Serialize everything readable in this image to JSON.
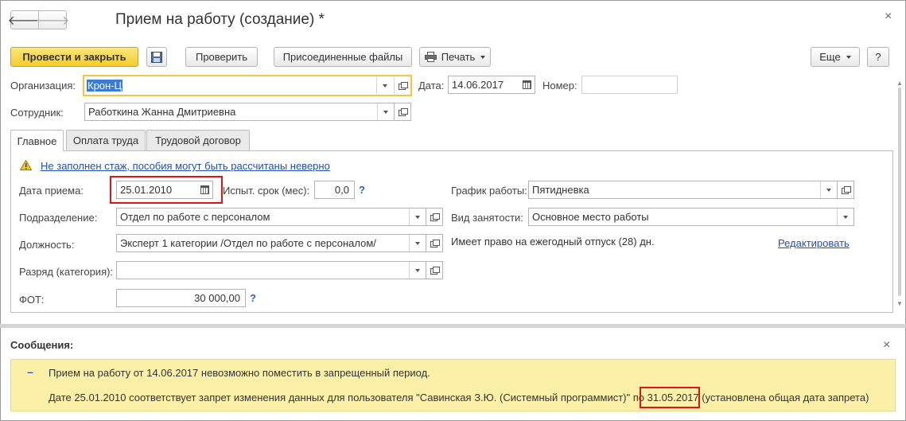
{
  "window": {
    "title": "Прием на работу (создание) *",
    "close_glyph": "×"
  },
  "nav": {
    "back_glyph": "🡐",
    "forward_glyph": "🡒"
  },
  "toolbar": {
    "post_close_label": "Провести и закрыть",
    "check_label": "Проверить",
    "attached_files_label": "Присоединенные файлы",
    "print_label": "Печать",
    "more_label": "Еще",
    "help_label": "?"
  },
  "header": {
    "organization": {
      "label": "Организация:",
      "value": "Крон-Ц"
    },
    "date": {
      "label": "Дата:",
      "value": "14.06.2017"
    },
    "number": {
      "label": "Номер:",
      "value": ""
    },
    "employee": {
      "label": "Сотрудник:",
      "value": "Работкина Жанна Дмитриевна"
    }
  },
  "tabs": [
    {
      "label": "Главное",
      "active": true
    },
    {
      "label": "Оплата труда",
      "active": false
    },
    {
      "label": "Трудовой договор",
      "active": false
    }
  ],
  "main": {
    "warning_link": "Не заполнен стаж, пособия могут быть рассчитаны неверно",
    "hire_date": {
      "label": "Дата приема:",
      "value": "25.01.2010"
    },
    "probation": {
      "label": "Испыт. срок (мес):",
      "value": "0,0",
      "help": "?"
    },
    "schedule": {
      "label": "График работы:",
      "value": "Пятидневка"
    },
    "department": {
      "label": "Подразделение:",
      "value": "Отдел по работе с персоналом"
    },
    "employment_type": {
      "label": "Вид занятости:",
      "value": "Основное место работы"
    },
    "position": {
      "label": "Должность:",
      "value": "Эксперт 1 категории /Отдел по работе с персоналом/"
    },
    "vacation_note": "Имеет право на ежегодный отпуск (28) дн.",
    "edit_link": "Редактировать",
    "grade": {
      "label": "Разряд (категория):",
      "value": ""
    },
    "payroll_fund": {
      "label": "ФОТ:",
      "value": "30 000,00",
      "help": "?"
    }
  },
  "messages": {
    "title": "Сообщения:",
    "close_glyph": "×",
    "dash_glyph": "–",
    "line1": "Прием на работу  от 14.06.2017 невозможно поместить в запрещенный период.",
    "line2_prefix": "Дате 25.01.2010 соответствует запрет изменения данных для пользователя \"Савинская З.Ю. (Системный программист)\" по ",
    "line2_date": "31.05.2017",
    "line2_suffix": " (установлена общая дата запрета)"
  },
  "colors": {
    "primary_button": "#f4cc2c",
    "message_background": "#fcf0a8",
    "highlight_frame": "#e01414",
    "link": "#1f4fb4"
  }
}
